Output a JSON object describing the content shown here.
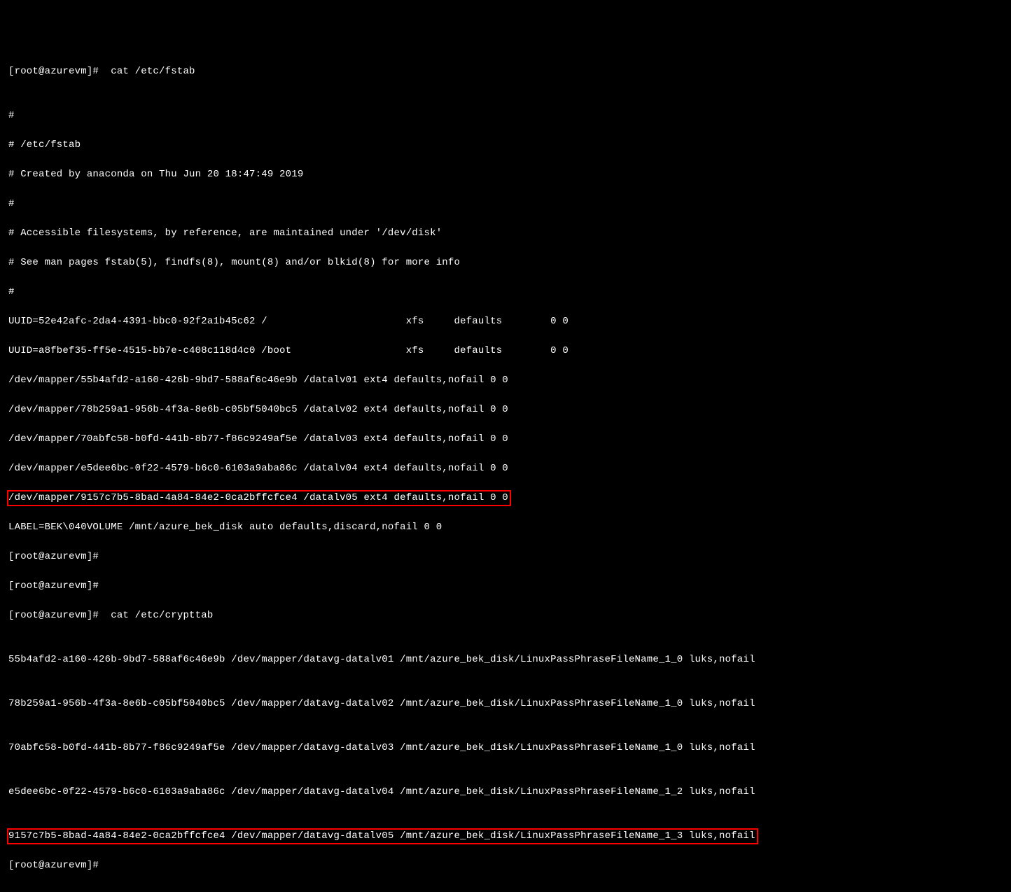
{
  "prompt_fstab": "[root@azurevm]#  cat /etc/fstab",
  "blank1": "",
  "fstab_comment1": "#",
  "fstab_comment2": "# /etc/fstab",
  "fstab_comment3": "# Created by anaconda on Thu Jun 20 18:47:49 2019",
  "fstab_comment4": "#",
  "fstab_comment5": "# Accessible filesystems, by reference, are maintained under '/dev/disk'",
  "fstab_comment6": "# See man pages fstab(5), findfs(8), mount(8) and/or blkid(8) for more info",
  "fstab_comment7": "#",
  "fstab_uuid1": "UUID=52e42afc-2da4-4391-bbc0-92f2a1b45c62 /                       xfs     defaults        0 0",
  "fstab_uuid2": "UUID=a8fbef35-ff5e-4515-bb7e-c408c118d4c0 /boot                   xfs     defaults        0 0",
  "fstab_line1": "/dev/mapper/55b4afd2-a160-426b-9bd7-588af6c46e9b /datalv01 ext4 defaults,nofail 0 0",
  "fstab_line2": "/dev/mapper/78b259a1-956b-4f3a-8e6b-c05bf5040bc5 /datalv02 ext4 defaults,nofail 0 0",
  "fstab_line3": "/dev/mapper/70abfc58-b0fd-441b-8b77-f86c9249af5e /datalv03 ext4 defaults,nofail 0 0",
  "fstab_line4": "/dev/mapper/e5dee6bc-0f22-4579-b6c0-6103a9aba86c /datalv04 ext4 defaults,nofail 0 0",
  "fstab_line5_hl": "/dev/mapper/9157c7b5-8bad-4a84-84e2-0ca2bffcfce4 /datalv05 ext4 defaults,nofail 0 0",
  "fstab_label": "LABEL=BEK\\040VOLUME /mnt/azure_bek_disk auto defaults,discard,nofail 0 0",
  "prompt_empty1": "[root@azurevm]#",
  "prompt_empty2": "[root@azurevm]#",
  "prompt_crypttab": "[root@azurevm]#  cat /etc/crypttab",
  "blank2": "",
  "crypt_line1": "55b4afd2-a160-426b-9bd7-588af6c46e9b /dev/mapper/datavg-datalv01 /mnt/azure_bek_disk/LinuxPassPhraseFileName_1_0 luks,nofail",
  "blank3": "",
  "crypt_line2": "78b259a1-956b-4f3a-8e6b-c05bf5040bc5 /dev/mapper/datavg-datalv02 /mnt/azure_bek_disk/LinuxPassPhraseFileName_1_0 luks,nofail",
  "blank4": "",
  "crypt_line3": "70abfc58-b0fd-441b-8b77-f86c9249af5e /dev/mapper/datavg-datalv03 /mnt/azure_bek_disk/LinuxPassPhraseFileName_1_0 luks,nofail",
  "blank5": "",
  "crypt_line4": "e5dee6bc-0f22-4579-b6c0-6103a9aba86c /dev/mapper/datavg-datalv04 /mnt/azure_bek_disk/LinuxPassPhraseFileName_1_2 luks,nofail",
  "blank6": "",
  "crypt_line5_hl": "9157c7b5-8bad-4a84-84e2-0ca2bffcfce4 /dev/mapper/datavg-datalv05 /mnt/azure_bek_disk/LinuxPassPhraseFileName_1_3 luks,nofail",
  "prompt_end": "[root@azurevm]#"
}
